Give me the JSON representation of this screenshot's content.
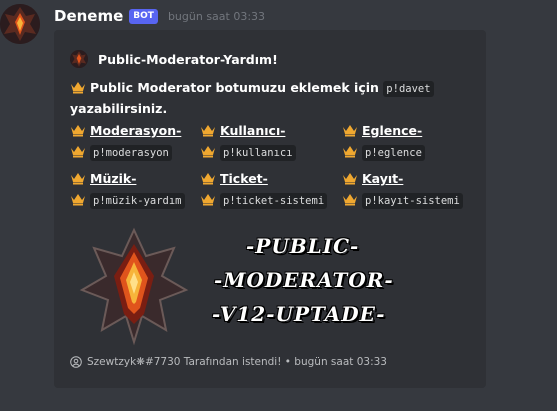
{
  "message": {
    "author": "Deneme",
    "bot_tag": "BOT",
    "timestamp": "bugün saat 03:33"
  },
  "embed": {
    "author_name": "Public-Moderator-Yardım!",
    "description_bold": "Public Moderator botumuzu eklemek için",
    "description_code": "p!davet",
    "description_tail": "yazabilirsiniz.",
    "fields": [
      {
        "name": "Moderasyon-",
        "value": "p!moderasyon"
      },
      {
        "name": "Kullanıcı-",
        "value": "p!kullanıcı"
      },
      {
        "name": "Eglence-",
        "value": "p!eglence"
      },
      {
        "name": "Müzik-",
        "value": "p!müzik-yardım"
      },
      {
        "name": "Ticket-",
        "value": "p!ticket-sistemi"
      },
      {
        "name": "Kayıt-",
        "value": "p!kayıt-sistemi"
      }
    ],
    "image_text": [
      "-PUBLIC-",
      "-MODERATOR-",
      "-V12-UPTADE-"
    ],
    "footer_text": "Szewtzyk❋#7730 Tarafından istendi! • bugün saat 03:33"
  },
  "colors": {
    "background": "#36393f",
    "embed_bg": "#2f3136",
    "bot_tag": "#5865f2",
    "crown": "#f0a830"
  },
  "icons": {
    "field_icon": "crown-icon",
    "avatar": "demon-emblem-avatar",
    "footer_icon": "discord-icon"
  }
}
